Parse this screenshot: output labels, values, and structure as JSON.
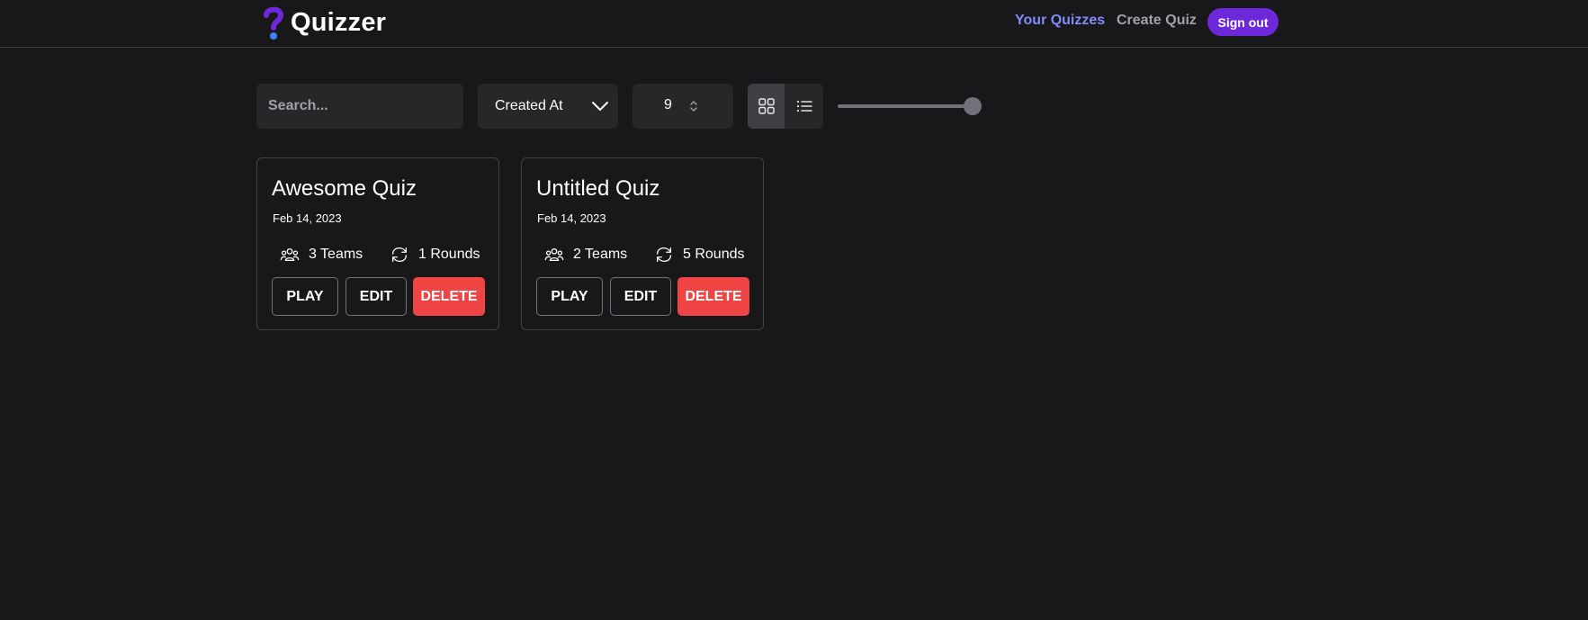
{
  "brand": {
    "name": "Quizzer",
    "logo_icon": "question-mark-icon",
    "logo_colors": {
      "top": "#6d28d9",
      "dot": "#3b82f6"
    }
  },
  "nav": {
    "your_quizzes": "Your Quizzes",
    "create_quiz": "Create Quiz",
    "sign_out": "Sign out"
  },
  "colors": {
    "accent": "#6d28d9",
    "active_link": "#818cf8",
    "delete": "#ef4444",
    "background": "#18181b"
  },
  "toolbar": {
    "search_placeholder": "Search...",
    "search_value": "",
    "sort_value": "Created At",
    "per_page_value": "9",
    "view_mode": "grid",
    "view_icons": [
      "grid-icon",
      "list-icon"
    ],
    "slider_fraction": 1.0
  },
  "quizzes": [
    {
      "title": "Awesome Quiz",
      "date": "Feb 14, 2023",
      "teams": "3 Teams",
      "rounds": "1 Rounds",
      "play": "PLAY",
      "edit": "EDIT",
      "delete": "DELETE"
    },
    {
      "title": "Untitled Quiz",
      "date": "Feb 14, 2023",
      "teams": "2 Teams",
      "rounds": "5 Rounds",
      "play": "PLAY",
      "edit": "EDIT",
      "delete": "DELETE"
    }
  ]
}
